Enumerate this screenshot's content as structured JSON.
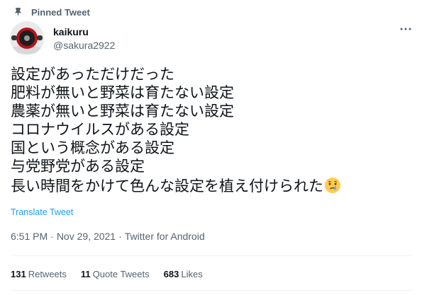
{
  "pinned_label": "Pinned Tweet",
  "author": {
    "name": "kaikuru",
    "handle": "@sakura2922"
  },
  "tweet_lines": [
    "設定があっただけだった",
    "肥料が無いと野菜は育たない設定",
    "農薬が無いと野菜は育たない設定",
    "コロナウイルスがある設定",
    "国という概念がある設定",
    "与党野党がある設定",
    "長い時間をかけて色んな設定を植え付けられた"
  ],
  "translate_label": "Translate Tweet",
  "meta": {
    "time": "6:51 PM",
    "date": "Nov 29, 2021",
    "separator": "·",
    "source": "Twitter for Android"
  },
  "stats": {
    "retweets": {
      "count": "131",
      "label": "Retweets"
    },
    "quotes": {
      "count": "11",
      "label": "Quote Tweets"
    },
    "likes": {
      "count": "683",
      "label": "Likes"
    }
  },
  "colors": {
    "link": "#1d9bf0",
    "muted": "#536471",
    "text": "#0f1419",
    "divider": "#eff3f4"
  },
  "icons": {
    "pin": "pin-icon",
    "more": "more-icon",
    "emoji": "crying-face-emoji"
  }
}
